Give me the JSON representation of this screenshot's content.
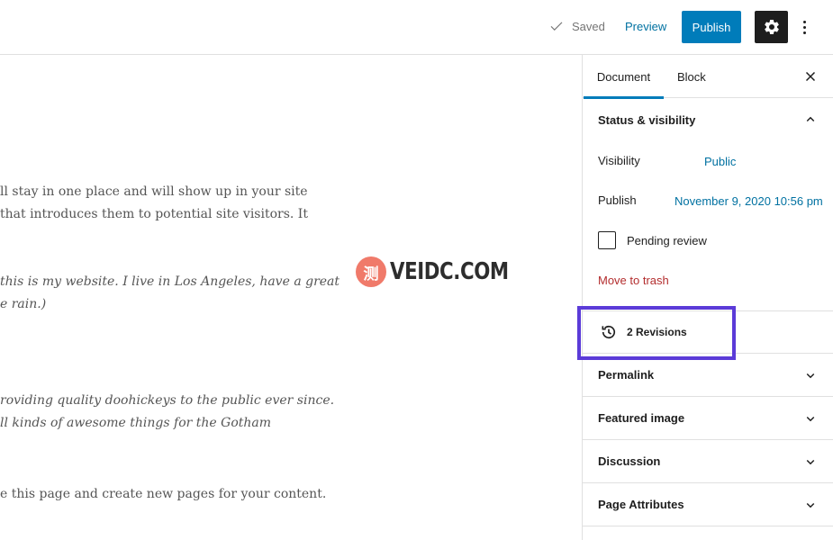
{
  "header": {
    "saved_label": "Saved",
    "preview_label": "Preview",
    "publish_label": "Publish"
  },
  "editor": {
    "paragraph1": [
      "ll stay in one place and will show up in your site",
      "that introduces them to potential site visitors. It"
    ],
    "paragraph2": [
      " this is my website. I live in Los Angeles, have a great",
      "e rain.)"
    ],
    "paragraph3": [
      "roviding quality doohickeys to the public ever since.",
      "ll kinds of awesome things for the Gotham"
    ],
    "paragraph4": [
      "e this page and create new pages for your content."
    ],
    "watermark_logo": "测",
    "watermark_text": "VEIDC.COM"
  },
  "sidebar": {
    "tabs": [
      {
        "label": "Document",
        "active": true
      },
      {
        "label": "Block",
        "active": false
      }
    ],
    "status_panel": {
      "title": "Status & visibility",
      "visibility_label": "Visibility",
      "visibility_value": "Public",
      "publish_label": "Publish",
      "publish_value": "November 9, 2020 10:56 pm",
      "pending_review_label": "Pending review",
      "pending_review_checked": false,
      "trash_label": "Move to trash"
    },
    "revisions_label": "2 Revisions",
    "panels": [
      {
        "title": "Permalink"
      },
      {
        "title": "Featured image"
      },
      {
        "title": "Discussion"
      },
      {
        "title": "Page Attributes"
      }
    ]
  },
  "colors": {
    "accent": "#007cba",
    "link": "#0071a1",
    "danger": "#b32d2e",
    "highlight": "#5b3bd8"
  }
}
